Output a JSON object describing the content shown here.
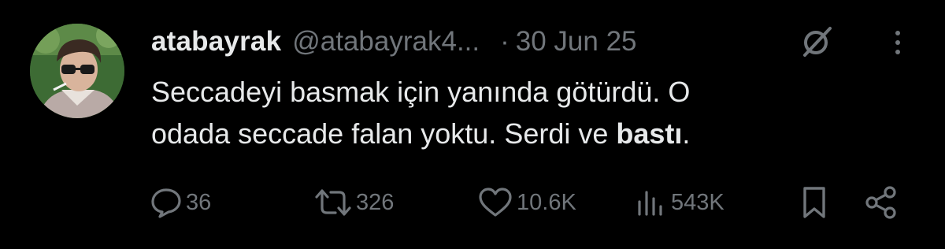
{
  "author": {
    "display_name": "atabayrak",
    "handle": "@atabayrak4...",
    "separator": "·",
    "date": "30 Jun 25"
  },
  "tweet": {
    "text_line1": "Seccadeyi basmak için yanında götürdü. O",
    "text_line2_prefix": "odada seccade falan yoktu. Serdi ve ",
    "text_line2_bold": "bastı",
    "text_line2_suffix": "."
  },
  "actions": {
    "replies": "36",
    "reposts": "326",
    "likes": "10.6K",
    "views": "543K"
  },
  "icons": {
    "reply": "reply-icon",
    "repost": "repost-icon",
    "like": "heart-icon",
    "views": "views-chart-icon",
    "bookmark": "bookmark-icon",
    "share": "share-icon",
    "grok": "grok-icon",
    "more": "more-vertical-icon"
  },
  "colors": {
    "background": "#000000",
    "text_primary": "#e7e9ea",
    "text_secondary": "#71767b"
  }
}
